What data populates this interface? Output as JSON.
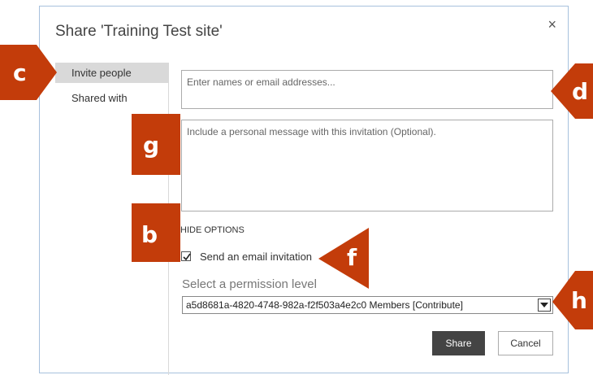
{
  "dialog": {
    "title": "Share 'Training Test site'",
    "close_glyph": "×"
  },
  "sidebar": {
    "items": [
      {
        "label": "Invite people",
        "active": true
      },
      {
        "label": "Shared with",
        "active": false
      }
    ]
  },
  "invite": {
    "names_placeholder": "Enter names or email addresses...",
    "message_placeholder": "Include a personal message with this invitation (Optional).",
    "hide_options_label": "HIDE OPTIONS",
    "send_email_label": "Send an email invitation",
    "send_email_checked": true,
    "permission_label": "Select a permission level",
    "permission_value": "a5d8681a-4820-4748-982a-f2f503a4e2c0 Members [Contribute]"
  },
  "buttons": {
    "share": "Share",
    "cancel": "Cancel"
  },
  "callouts": {
    "c": "c",
    "d": "d",
    "g": "g",
    "b": "b",
    "f": "f",
    "h": "h"
  },
  "colors": {
    "callout": "#c33c0a",
    "share_button": "#444444",
    "dialog_border": "#a7c1dd"
  }
}
